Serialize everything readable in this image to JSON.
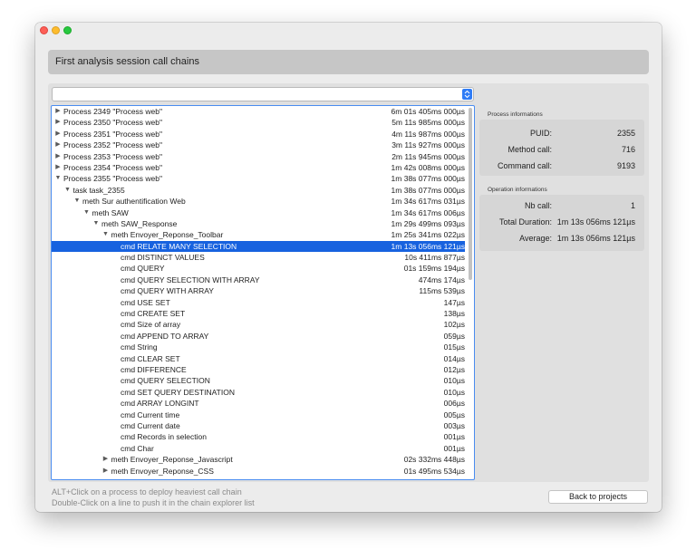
{
  "window": {
    "title": "First analysis session call chains"
  },
  "combo": {
    "value": ""
  },
  "tree_rows": [
    {
      "label": "Process 2349 \"Process web\"",
      "duration": "6m 01s 405ms 000µs",
      "level": 0,
      "expander": "collapsed",
      "selected": false
    },
    {
      "label": "Process 2350 \"Process web\"",
      "duration": "5m 11s 985ms 000µs",
      "level": 0,
      "expander": "collapsed",
      "selected": false
    },
    {
      "label": "Process 2351 \"Process web\"",
      "duration": "4m 11s 987ms 000µs",
      "level": 0,
      "expander": "collapsed",
      "selected": false
    },
    {
      "label": "Process 2352 \"Process web\"",
      "duration": "3m 11s 927ms 000µs",
      "level": 0,
      "expander": "collapsed",
      "selected": false
    },
    {
      "label": "Process 2353 \"Process web\"",
      "duration": "2m 11s 945ms 000µs",
      "level": 0,
      "expander": "collapsed",
      "selected": false
    },
    {
      "label": "Process 2354 \"Process web\"",
      "duration": "1m 42s 008ms 000µs",
      "level": 0,
      "expander": "collapsed",
      "selected": false
    },
    {
      "label": "Process 2355 \"Process web\"",
      "duration": "1m 38s 077ms 000µs",
      "level": 0,
      "expander": "expanded",
      "selected": false
    },
    {
      "label": "task task_2355",
      "duration": "1m 38s 077ms 000µs",
      "level": 1,
      "expander": "expanded",
      "selected": false
    },
    {
      "label": "meth Sur authentification Web",
      "duration": "1m 34s 617ms 031µs",
      "level": 2,
      "expander": "expanded",
      "selected": false
    },
    {
      "label": "meth SAW",
      "duration": "1m 34s 617ms 006µs",
      "level": 3,
      "expander": "expanded",
      "selected": false
    },
    {
      "label": "meth SAW_Response",
      "duration": "1m 29s 499ms 093µs",
      "level": 4,
      "expander": "expanded",
      "selected": false
    },
    {
      "label": "meth Envoyer_Reponse_Toolbar",
      "duration": "1m 25s 341ms 022µs",
      "level": 5,
      "expander": "expanded",
      "selected": false
    },
    {
      "label": "cmd RELATE MANY SELECTION",
      "duration": "1m 13s 056ms 121µs",
      "level": 6,
      "expander": "none",
      "selected": true
    },
    {
      "label": "cmd DISTINCT VALUES",
      "duration": "10s 411ms 877µs",
      "level": 6,
      "expander": "none",
      "selected": false
    },
    {
      "label": "cmd QUERY",
      "duration": "01s 159ms 194µs",
      "level": 6,
      "expander": "none",
      "selected": false
    },
    {
      "label": "cmd QUERY SELECTION WITH ARRAY",
      "duration": "474ms 174µs",
      "level": 6,
      "expander": "none",
      "selected": false
    },
    {
      "label": "cmd QUERY WITH ARRAY",
      "duration": "115ms 539µs",
      "level": 6,
      "expander": "none",
      "selected": false
    },
    {
      "label": "cmd USE SET",
      "duration": "147µs",
      "level": 6,
      "expander": "none",
      "selected": false
    },
    {
      "label": "cmd CREATE SET",
      "duration": "138µs",
      "level": 6,
      "expander": "none",
      "selected": false
    },
    {
      "label": "cmd Size of array",
      "duration": "102µs",
      "level": 6,
      "expander": "none",
      "selected": false
    },
    {
      "label": "cmd APPEND TO ARRAY",
      "duration": "059µs",
      "level": 6,
      "expander": "none",
      "selected": false
    },
    {
      "label": "cmd String",
      "duration": "015µs",
      "level": 6,
      "expander": "none",
      "selected": false
    },
    {
      "label": "cmd CLEAR SET",
      "duration": "014µs",
      "level": 6,
      "expander": "none",
      "selected": false
    },
    {
      "label": "cmd DIFFERENCE",
      "duration": "012µs",
      "level": 6,
      "expander": "none",
      "selected": false
    },
    {
      "label": "cmd QUERY SELECTION",
      "duration": "010µs",
      "level": 6,
      "expander": "none",
      "selected": false
    },
    {
      "label": "cmd SET QUERY DESTINATION",
      "duration": "010µs",
      "level": 6,
      "expander": "none",
      "selected": false
    },
    {
      "label": "cmd ARRAY LONGINT",
      "duration": "006µs",
      "level": 6,
      "expander": "none",
      "selected": false
    },
    {
      "label": "cmd Current time",
      "duration": "005µs",
      "level": 6,
      "expander": "none",
      "selected": false
    },
    {
      "label": "cmd Current date",
      "duration": "003µs",
      "level": 6,
      "expander": "none",
      "selected": false
    },
    {
      "label": "cmd Records in selection",
      "duration": "001µs",
      "level": 6,
      "expander": "none",
      "selected": false
    },
    {
      "label": "cmd Char",
      "duration": "001µs",
      "level": 6,
      "expander": "none",
      "selected": false
    },
    {
      "label": "meth Envoyer_Reponse_Javascript",
      "duration": "02s 332ms 448µs",
      "level": 5,
      "expander": "collapsed",
      "selected": false
    },
    {
      "label": "meth Envoyer_Reponse_CSS",
      "duration": "01s 495ms 534µs",
      "level": 5,
      "expander": "collapsed",
      "selected": false
    }
  ],
  "process_info": {
    "title": "Process informations",
    "puid_label": "PUID:",
    "puid_value": "2355",
    "method_label": "Method call:",
    "method_value": "716",
    "command_label": "Command call:",
    "command_value": "9193"
  },
  "operation_info": {
    "title": "Operation informations",
    "nb_label": "Nb call:",
    "nb_value": "1",
    "total_label": "Total Duration:",
    "total_value": "1m 13s 056ms 121µs",
    "avg_label": "Average:",
    "avg_value": "1m 13s 056ms 121µs"
  },
  "footer": {
    "hint_1": "ALT+Click on a process to deploy heaviest call chain",
    "hint_2": "Double-Click on a line to push it in the chain explorer list",
    "back_label": "Back to projects"
  },
  "icons": {
    "collapsed": "triangle-right-icon",
    "expanded": "triangle-down-icon",
    "combo": "up-down-chevron-icon"
  },
  "colors": {
    "selection": "#1762df",
    "focus_ring": "#4a8cf0",
    "close": "#fd5f57",
    "minimize": "#fdbc2e",
    "maximize": "#28c840"
  }
}
